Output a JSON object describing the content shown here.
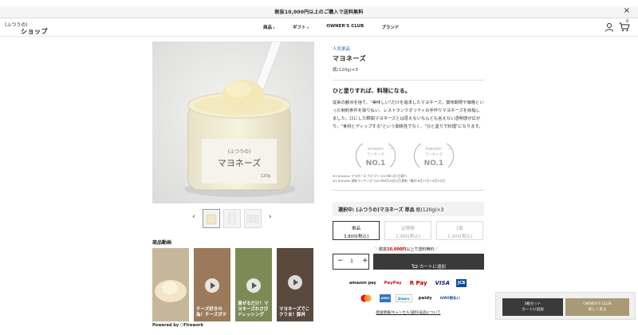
{
  "announcement": {
    "text": "税抜10,000円以上のご購入で送料無料",
    "close": "×"
  },
  "header": {
    "logo_small": "(ふつうの)",
    "logo_main": "ショップ",
    "nav": [
      {
        "label": "商品",
        "caret": "∨"
      },
      {
        "label": "ギフト",
        "caret": "∨"
      },
      {
        "label": "OWNER'S CLUB",
        "caret": ""
      },
      {
        "label": "ブランド",
        "caret": ""
      }
    ],
    "cart_count": "0"
  },
  "gallery": {
    "jar_label_small": "(ふつうの)",
    "jar_label_main": "マヨネーズ",
    "jar_label_weight": "120g"
  },
  "videos": {
    "title": "商品動画",
    "cards": [
      {
        "caption": ""
      },
      {
        "caption": "チーズ好きの為！チーズポテ"
      },
      {
        "caption": "混ぜるだけ！マヨネーズわさびドレッシング"
      },
      {
        "caption": "マヨネーズでこクうま！豚丼"
      }
    ],
    "powered_by": "Powered by ⬡Firework"
  },
  "product": {
    "category": "人気単品",
    "title": "マヨネーズ",
    "spec": "瓶(120g)×3",
    "lead": "ひと塗りすれば、料理になる。",
    "description": "従来の観点を捨て、\"美味しい\"だけを追求したマヨネーズ。賞味期限や価格といった制約条件を取り払い、レストランクオリティの手作りマヨネーズを目指しました。口にした瞬間マヨネーズとは思えないなんとも言えない透明感が広がり、\"食材とディップする\"という関係性でなく、\"ひと塗りで料理\"になります。",
    "badges": [
      {
        "brand": "amazon",
        "sub": "ランキング",
        "rank": "NO.1",
        "mark": "※1"
      },
      {
        "brand": "Rakuten",
        "sub": "ランキング",
        "rank": "NO.1",
        "mark": "※2"
      }
    ],
    "notes": [
      "※1 Amazon マヨネーズ カテゴリ 2023年1月7日調べ",
      "※2 Rakuten 調味ランキング 2023年6月26日(月)更新（集計:6月17日～6月23日）"
    ],
    "selected_label": "選択中:",
    "selected_value": "(ふつうの)マヨネーズ 単品",
    "selected_spec": "瓶(120g)×3",
    "options": [
      {
        "name": "単品",
        "price": "3,800[税込]",
        "state": "active"
      },
      {
        "name": "定期便",
        "price": "2,980[税込]",
        "state": "inactive"
      },
      {
        "name": "1瓶",
        "price": "1,300[税込]",
        "state": "inactive"
      }
    ],
    "ship_prefix": "＼税抜",
    "ship_amount": "10,000円",
    "ship_suffix": "以上で送料無料／",
    "qty_minus": "−",
    "qty_value": "1",
    "qty_plus": "+",
    "add_to_cart": "カートに追加",
    "payments_row1": [
      "amazon pay",
      "PayPay",
      "R Pay",
      "VISA",
      "JCB"
    ],
    "payments_row2": [
      "mastercard",
      "AMEX",
      "Diners",
      "paidy",
      "GMO後払い"
    ],
    "policy_link": "配送情報/キャンセル/送料/返品について"
  },
  "cta": {
    "dark_line1": "3瓶セット",
    "dark_line2": "カートに追加",
    "gold_line1": "OWNER'S CLUB",
    "gold_line2": "詳しく見る"
  },
  "colors": {
    "accent_blue": "#2a6eb0",
    "dark": "#3a3a3a",
    "gold": "#a89a74",
    "red": "#c40000"
  }
}
